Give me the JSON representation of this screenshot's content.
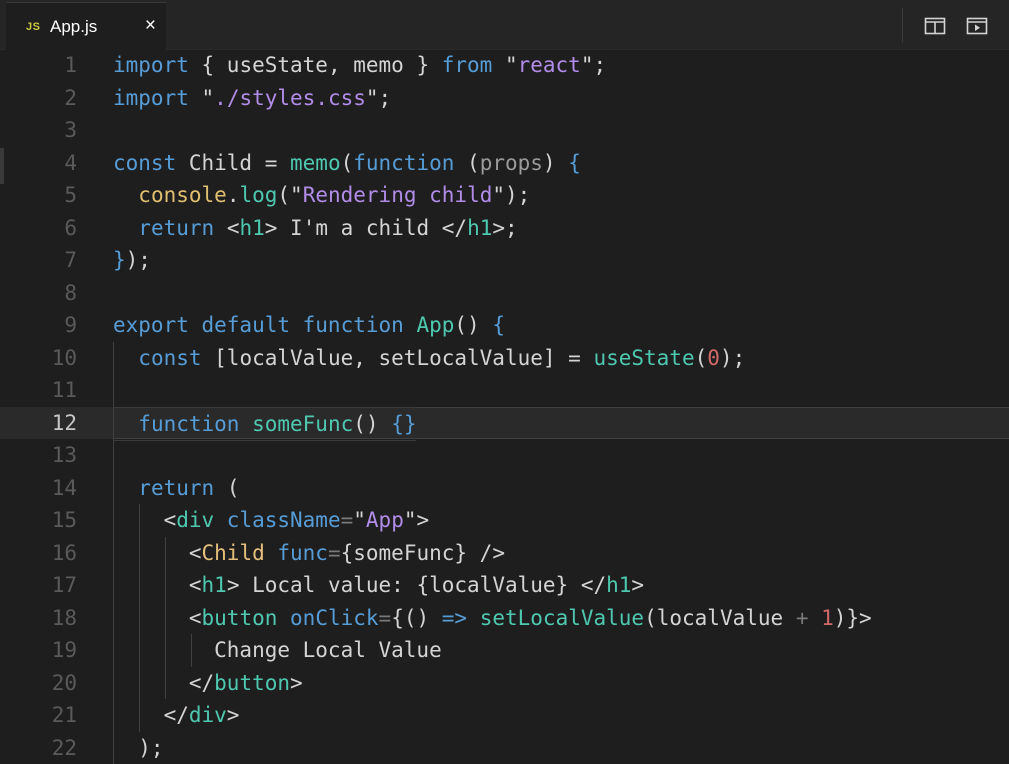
{
  "tab": {
    "type_badge": "JS",
    "filename": "App.js",
    "close": "×"
  },
  "toolbar": {
    "split_icon": "split-editor-icon",
    "preview_icon": "open-preview-icon"
  },
  "lines": [
    {
      "n": "1",
      "tokens": [
        [
          "kw",
          "import "
        ],
        [
          "pl",
          "{ useState, memo } "
        ],
        [
          "kw",
          "from "
        ],
        [
          "pl",
          "\""
        ],
        [
          "str2",
          "react"
        ],
        [
          "pl",
          "\";"
        ]
      ]
    },
    {
      "n": "2",
      "tokens": [
        [
          "kw",
          "import "
        ],
        [
          "pl",
          "\""
        ],
        [
          "str2",
          "./styles.css"
        ],
        [
          "pl",
          "\";"
        ]
      ]
    },
    {
      "n": "3",
      "tokens": []
    },
    {
      "n": "4",
      "tokens": [
        [
          "kw",
          "const "
        ],
        [
          "pl",
          "Child = "
        ],
        [
          "fn",
          "memo"
        ],
        [
          "pl",
          "("
        ],
        [
          "kw",
          "function "
        ],
        [
          "pl",
          "("
        ],
        [
          "par",
          "props"
        ],
        [
          "pl",
          ") "
        ],
        [
          "kw",
          "{"
        ]
      ]
    },
    {
      "n": "5",
      "tokens": [
        [
          "pl",
          "  "
        ],
        [
          "id",
          "console"
        ],
        [
          "pl",
          "."
        ],
        [
          "fn",
          "log"
        ],
        [
          "pl",
          "(\""
        ],
        [
          "str2",
          "Rendering child"
        ],
        [
          "pl",
          "\");"
        ]
      ]
    },
    {
      "n": "6",
      "tokens": [
        [
          "pl",
          "  "
        ],
        [
          "kw",
          "return "
        ],
        [
          "pl",
          "<"
        ],
        [
          "tag",
          "h1"
        ],
        [
          "pl",
          "> I'm a child </"
        ],
        [
          "tag",
          "h1"
        ],
        [
          "pl",
          ">;"
        ]
      ]
    },
    {
      "n": "7",
      "tokens": [
        [
          "kw",
          "}"
        ],
        [
          "pl",
          ");"
        ]
      ]
    },
    {
      "n": "8",
      "tokens": []
    },
    {
      "n": "9",
      "tokens": [
        [
          "kw",
          "export default function "
        ],
        [
          "fn",
          "App"
        ],
        [
          "pl",
          "() "
        ],
        [
          "kw",
          "{"
        ]
      ]
    },
    {
      "n": "10",
      "tokens": [
        [
          "pl",
          "  "
        ],
        [
          "kw",
          "const "
        ],
        [
          "pl",
          "[localValue, setLocalValue] = "
        ],
        [
          "fn",
          "useState"
        ],
        [
          "pl",
          "("
        ],
        [
          "num",
          "0"
        ],
        [
          "pl",
          ");"
        ]
      ]
    },
    {
      "n": "11",
      "tokens": []
    },
    {
      "n": "12",
      "tokens": [
        [
          "pl",
          "  "
        ],
        [
          "kw",
          "function "
        ],
        [
          "fn",
          "someFunc"
        ],
        [
          "pl",
          "() "
        ],
        [
          "kw",
          "{}"
        ]
      ],
      "current": true
    },
    {
      "n": "13",
      "tokens": []
    },
    {
      "n": "14",
      "tokens": [
        [
          "pl",
          "  "
        ],
        [
          "kw",
          "return "
        ],
        [
          "pl",
          "("
        ]
      ]
    },
    {
      "n": "15",
      "tokens": [
        [
          "pl",
          "    <"
        ],
        [
          "tag",
          "div "
        ],
        [
          "attr",
          "className"
        ],
        [
          "op",
          "="
        ],
        [
          "pl",
          "\""
        ],
        [
          "str2",
          "App"
        ],
        [
          "pl",
          "\">"
        ]
      ]
    },
    {
      "n": "16",
      "tokens": [
        [
          "pl",
          "      <"
        ],
        [
          "comp",
          "Child "
        ],
        [
          "attr",
          "func"
        ],
        [
          "op",
          "="
        ],
        [
          "pl",
          "{someFunc} />"
        ]
      ]
    },
    {
      "n": "17",
      "tokens": [
        [
          "pl",
          "      <"
        ],
        [
          "tag",
          "h1"
        ],
        [
          "pl",
          "> Local value: {localValue} </"
        ],
        [
          "tag",
          "h1"
        ],
        [
          "pl",
          ">"
        ]
      ]
    },
    {
      "n": "18",
      "tokens": [
        [
          "pl",
          "      <"
        ],
        [
          "tag",
          "button "
        ],
        [
          "attr",
          "onClick"
        ],
        [
          "op",
          "="
        ],
        [
          "pl",
          "{() "
        ],
        [
          "kw",
          "=> "
        ],
        [
          "fn",
          "setLocalValue"
        ],
        [
          "pl",
          "(localValue "
        ],
        [
          "op",
          "+ "
        ],
        [
          "num",
          "1"
        ],
        [
          "pl",
          ")}>"
        ]
      ]
    },
    {
      "n": "19",
      "tokens": [
        [
          "pl",
          "        Change Local Value"
        ]
      ]
    },
    {
      "n": "20",
      "tokens": [
        [
          "pl",
          "      </"
        ],
        [
          "tag",
          "button"
        ],
        [
          "pl",
          ">"
        ]
      ]
    },
    {
      "n": "21",
      "tokens": [
        [
          "pl",
          "    </"
        ],
        [
          "tag",
          "div"
        ],
        [
          "pl",
          ">"
        ]
      ]
    },
    {
      "n": "22",
      "tokens": [
        [
          "pl",
          "  );"
        ]
      ]
    }
  ]
}
